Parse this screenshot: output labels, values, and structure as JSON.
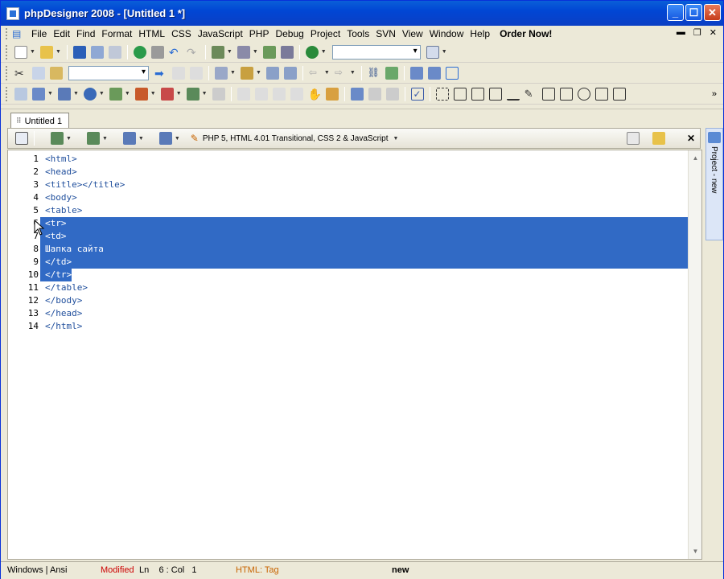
{
  "window": {
    "title": "phpDesigner 2008 - [Untitled 1 *]"
  },
  "menu": [
    "File",
    "Edit",
    "Find",
    "Format",
    "HTML",
    "CSS",
    "JavaScript",
    "PHP",
    "Debug",
    "Project",
    "Tools",
    "SVN",
    "View",
    "Window",
    "Help"
  ],
  "menu_bold": "Order Now!",
  "tab": {
    "label": "Untitled 1"
  },
  "editor_toolbar": {
    "language": "PHP 5, HTML 4.01 Transitional, CSS 2 & JavaScript"
  },
  "side_panel": {
    "label": "Project - new"
  },
  "code_lines": [
    {
      "n": "1",
      "text": "<html>"
    },
    {
      "n": "2",
      "text": "<head>"
    },
    {
      "n": "3",
      "text": "<title></title>"
    },
    {
      "n": "4",
      "text": "<body>"
    },
    {
      "n": "5",
      "text": "<table>"
    },
    {
      "n": "6",
      "text": "<tr>"
    },
    {
      "n": "7",
      "text": "<td>"
    },
    {
      "n": "8",
      "text": "Шапка сайта"
    },
    {
      "n": "9",
      "text": "</td>"
    },
    {
      "n": "10",
      "text": "</tr>"
    },
    {
      "n": "11",
      "text": "</table>"
    },
    {
      "n": "12",
      "text": "</body>"
    },
    {
      "n": "13",
      "text": "</head>"
    },
    {
      "n": "14",
      "text": "</html>"
    }
  ],
  "status": {
    "encoding": "Windows | Ansi",
    "modified": "Modified",
    "position": "Ln    6 : Col   1",
    "context": "HTML: Tag",
    "project": "new"
  },
  "colors": {
    "selection": "#316ac5",
    "titlebar": "#0146d4",
    "modified": "#cc0000",
    "context": "#c86400"
  }
}
